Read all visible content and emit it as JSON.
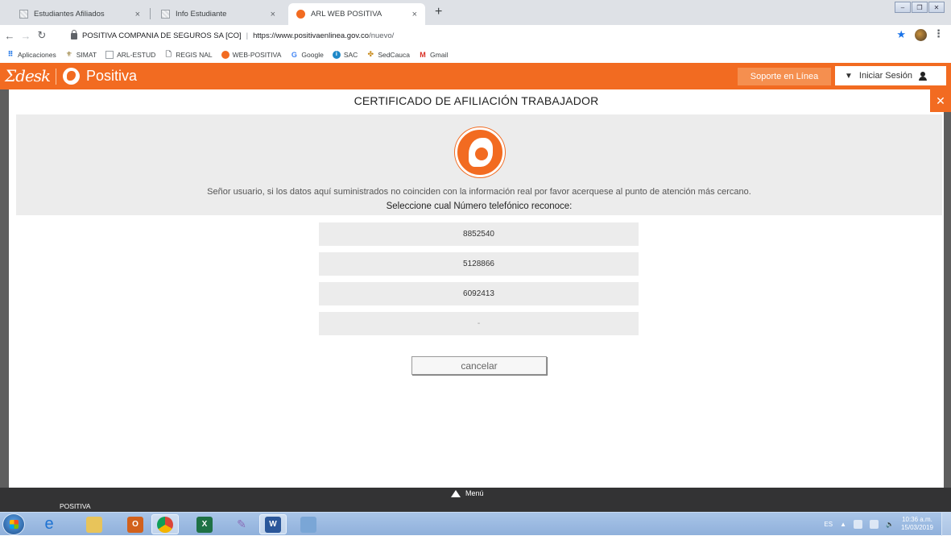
{
  "browser": {
    "tabs": [
      {
        "label": "Estudiantes Afiliados"
      },
      {
        "label": "Info Estudiante"
      },
      {
        "label": "ARL WEB POSITIVA"
      }
    ],
    "url": {
      "site_name": "POSITIVA COMPANIA DE SEGUROS SA [CO]",
      "host": "https://www.positivaenlinea.gov.co",
      "path": "/nuevo/"
    },
    "bookmarks": [
      {
        "label": "Aplicaciones",
        "icon": "apps-grid-icon"
      },
      {
        "label": "SIMAT",
        "icon": "shield-emblem-icon"
      },
      {
        "label": "ARL-ESTUD",
        "icon": "page-icon"
      },
      {
        "label": "REGIS NAL",
        "icon": "document-icon"
      },
      {
        "label": "WEB-POSITIVA",
        "icon": "positiva-icon"
      },
      {
        "label": "Google",
        "icon": "google-g-icon"
      },
      {
        "label": "SAC",
        "icon": "sac-icon"
      },
      {
        "label": "SedCauca",
        "icon": "sedcauca-icon"
      },
      {
        "label": "Gmail",
        "icon": "gmail-icon"
      }
    ]
  },
  "header": {
    "logo_text": "Σdesk",
    "brand": "Positiva",
    "support_label": "Soporte en Línea",
    "login_label": "Iniciar Sesión"
  },
  "modal": {
    "title": "CERTIFICADO DE AFILIACIÓN TRABAJADOR",
    "close_label": "✕",
    "message": "Señor usuario, si los datos aquí suministrados no coinciden con la información real por favor acerquese al punto de atención más cercano.",
    "prompt": "Seleccione cual Número telefónico reconoce:",
    "phone_options": [
      "8852540",
      "5128866",
      "6092413",
      "-"
    ],
    "cancel_label": "cancelar"
  },
  "footer": {
    "menu_label": "Menú",
    "brand": "POSITIVA"
  },
  "taskbar": {
    "language": "ES",
    "time": "10:36 a.m.",
    "date": "15/03/2019"
  },
  "colors": {
    "brand_orange": "#f26b21",
    "panel_gray": "#ececec",
    "footer_dark": "#333334"
  }
}
